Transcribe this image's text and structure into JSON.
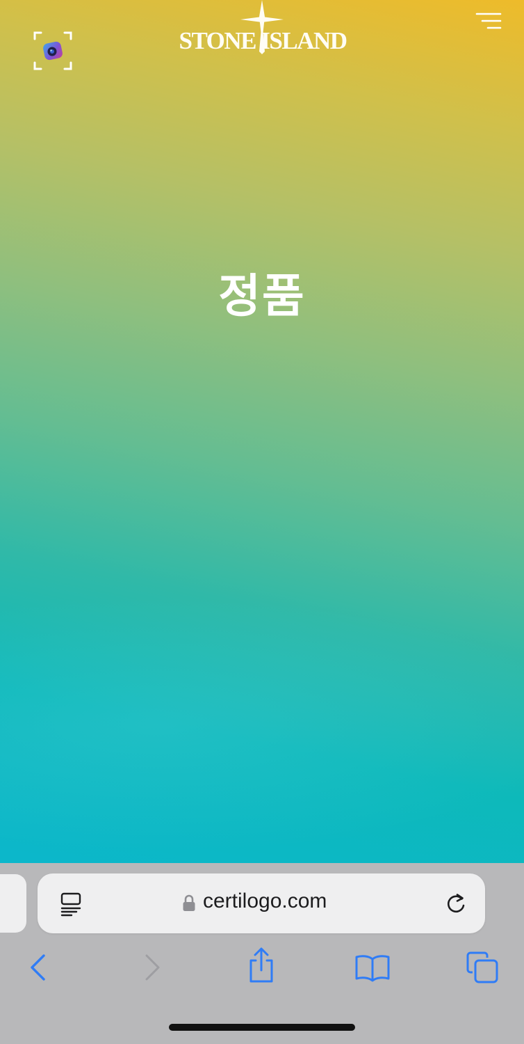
{
  "header": {
    "brand": "STONE ISLAND",
    "scan_icon": "camera-scan-icon",
    "menu_icon": "hamburger-menu-icon"
  },
  "main": {
    "result_title": "정품"
  },
  "browser": {
    "url": "certilogo.com",
    "reader_icon": "reader-view-icon",
    "lock_icon": "lock-icon",
    "reload_icon": "reload-icon",
    "toolbar_icons": [
      "back-chevron-icon",
      "forward-chevron-icon",
      "share-icon",
      "bookmarks-icon",
      "tabs-icon"
    ]
  },
  "colors": {
    "gradient_top": "#eebb2a",
    "gradient_mid": "#64bd92",
    "gradient_bottom": "#0cb7cb",
    "safari_blue": "#2f7cf6",
    "chrome_bg": "#b8b8ba"
  }
}
